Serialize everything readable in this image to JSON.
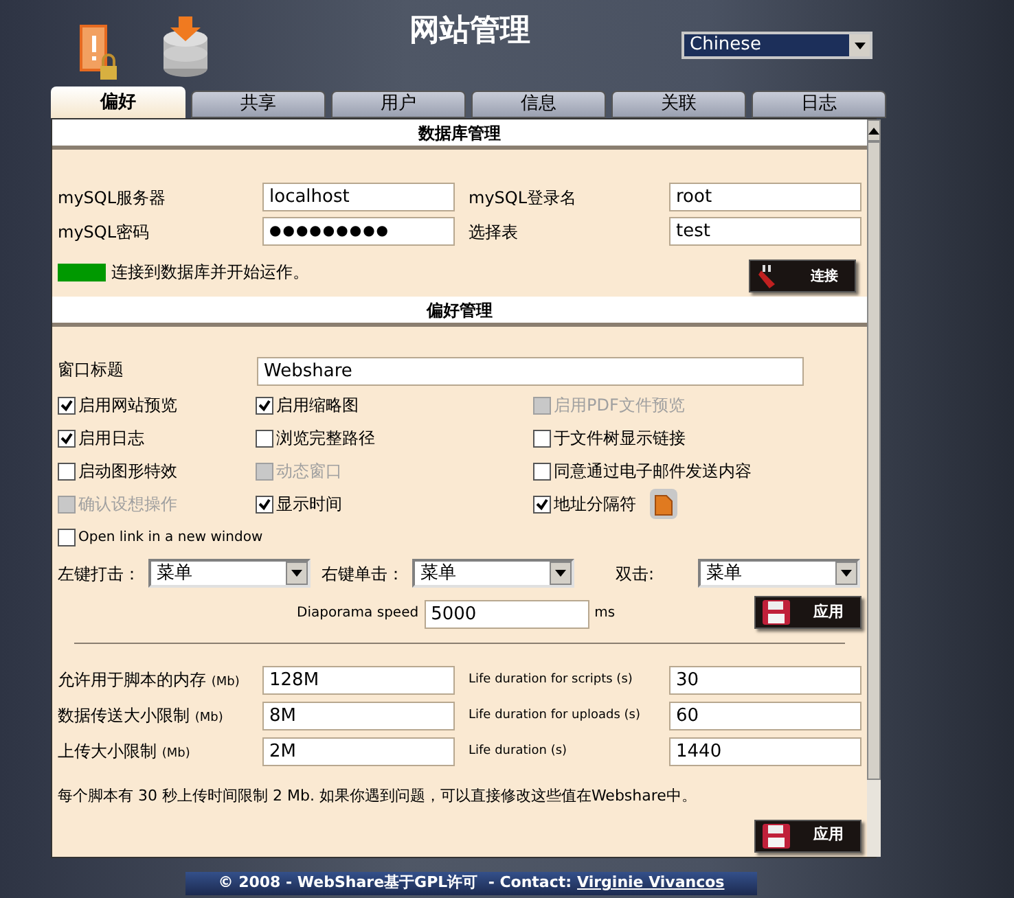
{
  "header": {
    "title": "网站管理",
    "language": "Chinese"
  },
  "tabs": [
    {
      "label": "偏好",
      "selected": true
    },
    {
      "label": "共享",
      "selected": false
    },
    {
      "label": "用户",
      "selected": false
    },
    {
      "label": "信息",
      "selected": false
    },
    {
      "label": "关联",
      "selected": false
    },
    {
      "label": "日志",
      "selected": false
    }
  ],
  "database": {
    "title": "数据库管理",
    "fields": [
      {
        "label": "mySQL服务器",
        "value": "localhost",
        "kind": "text"
      },
      {
        "label": "mySQL登录名",
        "value": "root",
        "kind": "text"
      },
      {
        "label": "mySQL密码",
        "value": "●●●●●●●●●",
        "kind": "password"
      },
      {
        "label": "选择表",
        "value": "test",
        "kind": "text"
      }
    ],
    "status": {
      "text": "连接到数据库并开始运作。",
      "connected": true
    },
    "connect_button": "连接"
  },
  "preferences": {
    "title": "偏好管理",
    "window_title": {
      "label": "窗口标题",
      "value": "Webshare"
    },
    "options": [
      {
        "label": "启用网站预览",
        "checked": true,
        "disabled": false,
        "kind": "plain"
      },
      {
        "label": "启用缩略图",
        "checked": true,
        "disabled": false,
        "kind": "plain"
      },
      {
        "label": "启用PDF文件预览",
        "checked": false,
        "disabled": true,
        "kind": "plain"
      },
      {
        "label": "启用日志",
        "checked": true,
        "disabled": false,
        "kind": "plain"
      },
      {
        "label": "浏览完整路径",
        "checked": false,
        "disabled": false,
        "kind": "plain"
      },
      {
        "label": "于文件树显示链接",
        "checked": false,
        "disabled": false,
        "kind": "plain"
      },
      {
        "label": "启动图形特效",
        "checked": false,
        "disabled": false,
        "kind": "plain"
      },
      {
        "label": "动态窗口",
        "checked": false,
        "disabled": true,
        "kind": "plain"
      },
      {
        "label": "同意通过电子邮件发送内容",
        "checked": false,
        "disabled": false,
        "kind": "plain"
      },
      {
        "label": "确认设想操作",
        "checked": false,
        "disabled": true,
        "kind": "plain"
      },
      {
        "label": "显示时间",
        "checked": true,
        "disabled": false,
        "kind": "plain"
      },
      {
        "label": "地址分隔符",
        "checked": true,
        "disabled": false,
        "kind": "with_icon"
      },
      {
        "label": "Open link in a new window",
        "checked": false,
        "disabled": false,
        "kind": "plain"
      }
    ],
    "clicks": [
      {
        "label": "左键打击：",
        "value": "菜单"
      },
      {
        "label": "右键单击：",
        "value": "菜单"
      },
      {
        "label": "双击:",
        "value": "菜单"
      }
    ],
    "diaporama": {
      "label": "Diaporama speed",
      "value": "5000",
      "unit": "ms"
    },
    "apply_button": "应用",
    "limits": [
      {
        "label": "允许用于脚本的内存",
        "unit": "(Mb)",
        "value": "128M",
        "label2": "Life duration for scripts (s)",
        "value2": "30"
      },
      {
        "label": "数据传送大小限制",
        "unit": "(Mb)",
        "value": "8M",
        "label2": "Life duration for uploads (s)",
        "value2": "60"
      },
      {
        "label": "上传大小限制",
        "unit": "(Mb)",
        "value": "2M",
        "label2": "Life duration (s)",
        "value2": "1440"
      }
    ],
    "note": "每个脚本有 30 秒上传时间限制 2 Mb. 如果你遇到问题，可以直接修改这些值在Webshare中。",
    "apply_button_2": "应用"
  },
  "footer": {
    "text": "© 2008 - WebShare基于GPL许可  - Contact:",
    "link": "Virginie Vivancos"
  }
}
